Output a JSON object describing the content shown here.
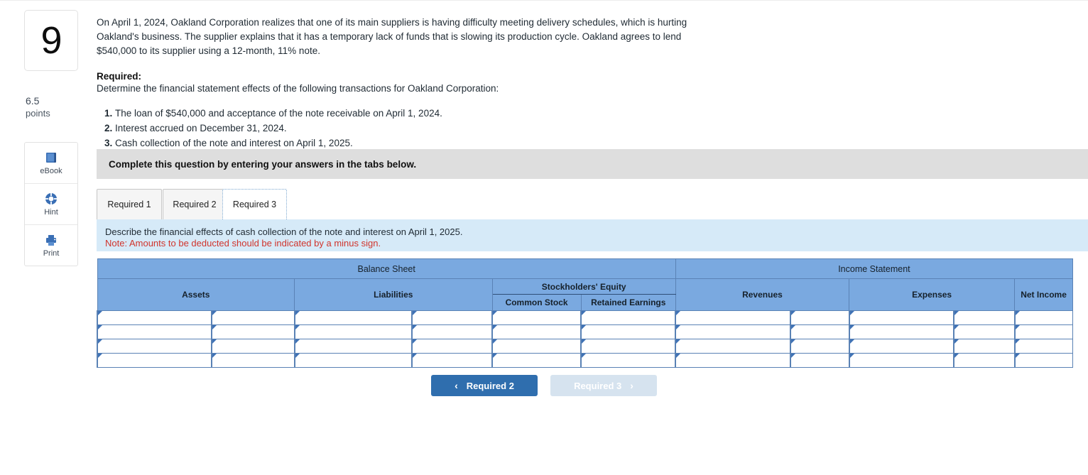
{
  "sidebar": {
    "question_number": "9",
    "points_value": "6.5",
    "points_label": "points",
    "tools": [
      {
        "label": "eBook",
        "icon": "ebook-icon"
      },
      {
        "label": "Hint",
        "icon": "lifebuoy-icon"
      },
      {
        "label": "Print",
        "icon": "printer-icon"
      }
    ]
  },
  "problem": {
    "stem": "On April 1, 2024, Oakland Corporation realizes that one of its main suppliers is having difficulty meeting delivery schedules, which is hurting Oakland's business. The supplier explains that it has a temporary lack of funds that is slowing its production cycle. Oakland agrees to lend $540,000 to its supplier using a 12-month, 11% note.",
    "required_heading": "Required:",
    "required_sub": "Determine the financial statement effects of the following transactions for Oakland Corporation:",
    "required_items": [
      "The loan of $540,000 and acceptance of the note receivable on April 1, 2024.",
      "Interest accrued on December 31, 2024.",
      "Cash collection of the note and interest on April 1, 2025."
    ]
  },
  "banner": {
    "text": "Complete this question by entering your answers in the tabs below."
  },
  "tabs": [
    {
      "label": "Required 1",
      "active": false
    },
    {
      "label": "Required 2",
      "active": false
    },
    {
      "label": "Required 3",
      "active": true
    }
  ],
  "instructions": {
    "line1": "Describe the financial effects of cash collection of the note and interest on April 1, 2025.",
    "note": "Note: Amounts to be deducted should be indicated by a minus sign."
  },
  "table": {
    "group_headers": [
      "Balance Sheet",
      "Income Statement"
    ],
    "columns": [
      "Assets",
      "Liabilities",
      "Stockholders' Equity",
      "Revenues",
      "Expenses",
      "Net Income"
    ],
    "equity_subcolumns": [
      "Common Stock",
      "Retained Earnings"
    ],
    "row_count": 4,
    "rows": [
      {
        "assets_label": "",
        "assets_value": "",
        "liabilities_label": "",
        "liabilities_value": "",
        "common_stock": "",
        "retained_earnings": "",
        "revenues_label": "",
        "revenues_value": "",
        "expenses_label": "",
        "expenses_value": "",
        "net_income": ""
      },
      {
        "assets_label": "",
        "assets_value": "",
        "liabilities_label": "",
        "liabilities_value": "",
        "common_stock": "",
        "retained_earnings": "",
        "revenues_label": "",
        "revenues_value": "",
        "expenses_label": "",
        "expenses_value": "",
        "net_income": ""
      },
      {
        "assets_label": "",
        "assets_value": "",
        "liabilities_label": "",
        "liabilities_value": "",
        "common_stock": "",
        "retained_earnings": "",
        "revenues_label": "",
        "revenues_value": "",
        "expenses_label": "",
        "expenses_value": "",
        "net_income": ""
      },
      {
        "assets_label": "",
        "assets_value": "",
        "liabilities_label": "",
        "liabilities_value": "",
        "common_stock": "",
        "retained_earnings": "",
        "revenues_label": "",
        "revenues_value": "",
        "expenses_label": "",
        "expenses_value": "",
        "net_income": ""
      }
    ]
  },
  "nav": {
    "prev_label": "Required 2",
    "prev_chevron": "‹",
    "next_label": "Required 3",
    "next_chevron": "›"
  },
  "colors": {
    "header_blue": "#7aa9e0",
    "band_grey": "#dedede",
    "band_lightblue": "#d6eaf8",
    "note_red": "#d0342c",
    "button_blue": "#2f6eae",
    "button_disabled": "#d6e3ef"
  }
}
